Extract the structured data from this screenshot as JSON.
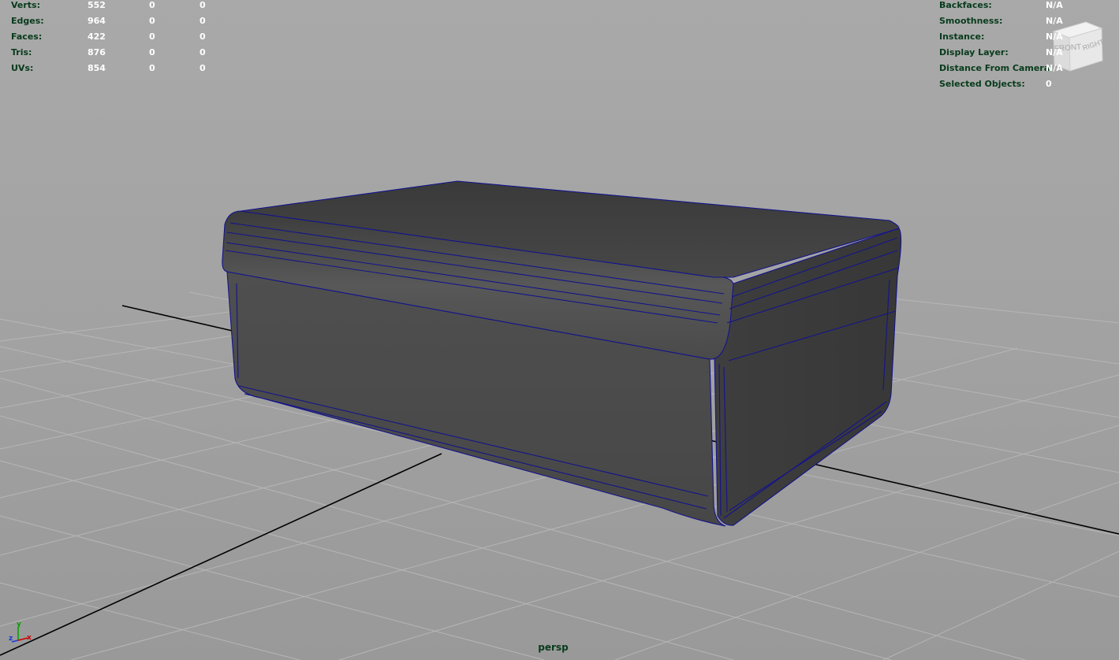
{
  "stats": [
    {
      "label": "Verts:",
      "total": "552",
      "selected": "0",
      "component": "0"
    },
    {
      "label": "Edges:",
      "total": "964",
      "selected": "0",
      "component": "0"
    },
    {
      "label": "Faces:",
      "total": "422",
      "selected": "0",
      "component": "0"
    },
    {
      "label": "Tris:",
      "total": "876",
      "selected": "0",
      "component": "0"
    },
    {
      "label": "UVs:",
      "total": "854",
      "selected": "0",
      "component": "0"
    }
  ],
  "info": [
    {
      "label": "Backfaces:",
      "value": "N/A"
    },
    {
      "label": "Smoothness:",
      "value": "N/A"
    },
    {
      "label": "Instance:",
      "value": "N/A"
    },
    {
      "label": "Display Layer:",
      "value": "N/A"
    },
    {
      "label": "Distance From Camera:",
      "value": "N/A"
    },
    {
      "label": "Selected Objects:",
      "value": "0"
    }
  ],
  "view_cube": {
    "front": "FRONT",
    "right": "RIGHT"
  },
  "axis_triad": {
    "x": "x",
    "y": "y",
    "z": "z"
  },
  "camera_label": "persp",
  "colors": {
    "wireframe": "#14148c",
    "grid": "#b4b4b4",
    "axis_lines": "#000000",
    "hud_label": "#073b1b",
    "hud_value": "#ffffff"
  }
}
